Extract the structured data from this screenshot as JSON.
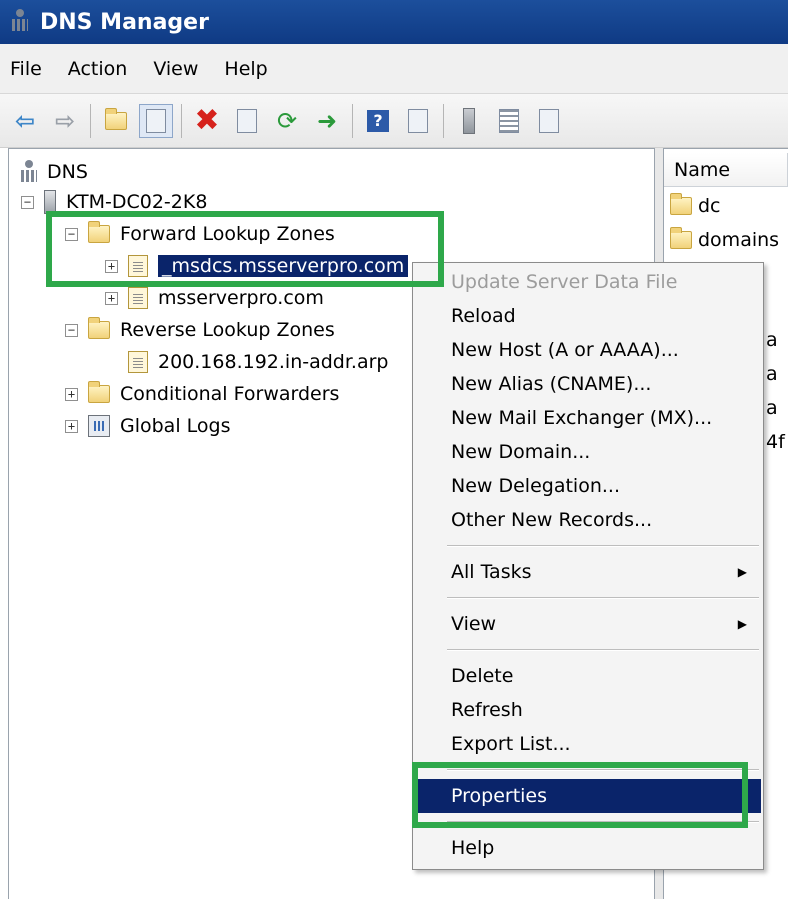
{
  "window": {
    "title": "DNS Manager"
  },
  "menubar": {
    "items": [
      "File",
      "Action",
      "View",
      "Help"
    ]
  },
  "toolbar": {
    "buttons": [
      "back-arrow-icon",
      "forward-arrow-icon",
      "up-folder-icon",
      "show-hide-console-tree-icon",
      "delete-icon",
      "properties-icon",
      "refresh-icon",
      "export-list-icon",
      "help-icon",
      "show-action-pane-icon",
      "server-icon",
      "list-icon",
      "document-icon"
    ],
    "help_glyph": "?",
    "delete_glyph": "✖"
  },
  "tree": {
    "dns_label": "DNS",
    "server_label": "KTM-DC02-2K8",
    "forward_zones_label": "Forward Lookup Zones",
    "msdcs_label": "_msdcs.msserverpro.com",
    "msserverpro_label": "msserverpro.com",
    "reverse_zones_label": "Reverse Lookup Zones",
    "reverse_zone_label": "200.168.192.in-addr.arp",
    "conditional_forwarders_label": "Conditional Forwarders",
    "global_logs_label": "Global Logs",
    "expand_glyph": "+",
    "collapse_glyph": "−"
  },
  "list": {
    "column_name": "Name",
    "rows": [
      "dc",
      "domains"
    ],
    "clipped_texts": [
      "a",
      "a",
      "a",
      "4f"
    ]
  },
  "context_menu": {
    "items": [
      {
        "label": "Update Server Data File",
        "disabled": true
      },
      {
        "label": "Reload"
      },
      {
        "label": "New Host (A or AAAA)..."
      },
      {
        "label": "New Alias (CNAME)..."
      },
      {
        "label": "New Mail Exchanger (MX)..."
      },
      {
        "label": "New Domain..."
      },
      {
        "label": "New Delegation..."
      },
      {
        "label": "Other New Records..."
      },
      {
        "label": "All Tasks",
        "submenu": true
      },
      {
        "label": "View",
        "submenu": true
      },
      {
        "label": "Delete"
      },
      {
        "label": "Refresh"
      },
      {
        "label": "Export List..."
      },
      {
        "label": "Properties",
        "highlighted": true
      },
      {
        "label": "Help"
      }
    ],
    "submenu_glyph": "▶"
  },
  "colors": {
    "title_bar": "#1c4f9c",
    "selection": "#0a246a",
    "annotation_green": "#2ea84a"
  }
}
